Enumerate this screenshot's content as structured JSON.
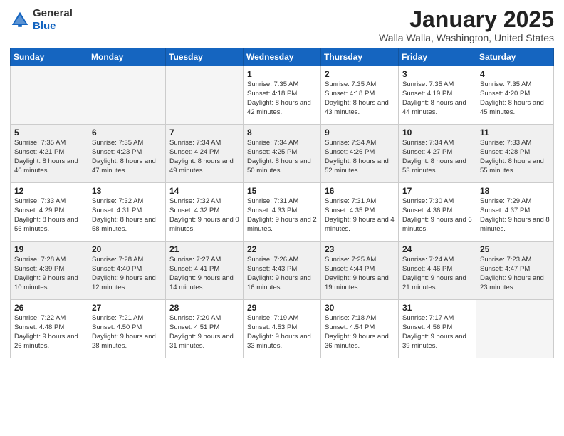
{
  "header": {
    "logo_general": "General",
    "logo_blue": "Blue",
    "month_title": "January 2025",
    "location": "Walla Walla, Washington, United States"
  },
  "weekdays": [
    "Sunday",
    "Monday",
    "Tuesday",
    "Wednesday",
    "Thursday",
    "Friday",
    "Saturday"
  ],
  "weeks": [
    [
      {
        "day": "",
        "info": ""
      },
      {
        "day": "",
        "info": ""
      },
      {
        "day": "",
        "info": ""
      },
      {
        "day": "1",
        "info": "Sunrise: 7:35 AM\nSunset: 4:18 PM\nDaylight: 8 hours and 42 minutes."
      },
      {
        "day": "2",
        "info": "Sunrise: 7:35 AM\nSunset: 4:18 PM\nDaylight: 8 hours and 43 minutes."
      },
      {
        "day": "3",
        "info": "Sunrise: 7:35 AM\nSunset: 4:19 PM\nDaylight: 8 hours and 44 minutes."
      },
      {
        "day": "4",
        "info": "Sunrise: 7:35 AM\nSunset: 4:20 PM\nDaylight: 8 hours and 45 minutes."
      }
    ],
    [
      {
        "day": "5",
        "info": "Sunrise: 7:35 AM\nSunset: 4:21 PM\nDaylight: 8 hours and 46 minutes."
      },
      {
        "day": "6",
        "info": "Sunrise: 7:35 AM\nSunset: 4:23 PM\nDaylight: 8 hours and 47 minutes."
      },
      {
        "day": "7",
        "info": "Sunrise: 7:34 AM\nSunset: 4:24 PM\nDaylight: 8 hours and 49 minutes."
      },
      {
        "day": "8",
        "info": "Sunrise: 7:34 AM\nSunset: 4:25 PM\nDaylight: 8 hours and 50 minutes."
      },
      {
        "day": "9",
        "info": "Sunrise: 7:34 AM\nSunset: 4:26 PM\nDaylight: 8 hours and 52 minutes."
      },
      {
        "day": "10",
        "info": "Sunrise: 7:34 AM\nSunset: 4:27 PM\nDaylight: 8 hours and 53 minutes."
      },
      {
        "day": "11",
        "info": "Sunrise: 7:33 AM\nSunset: 4:28 PM\nDaylight: 8 hours and 55 minutes."
      }
    ],
    [
      {
        "day": "12",
        "info": "Sunrise: 7:33 AM\nSunset: 4:29 PM\nDaylight: 8 hours and 56 minutes."
      },
      {
        "day": "13",
        "info": "Sunrise: 7:32 AM\nSunset: 4:31 PM\nDaylight: 8 hours and 58 minutes."
      },
      {
        "day": "14",
        "info": "Sunrise: 7:32 AM\nSunset: 4:32 PM\nDaylight: 9 hours and 0 minutes."
      },
      {
        "day": "15",
        "info": "Sunrise: 7:31 AM\nSunset: 4:33 PM\nDaylight: 9 hours and 2 minutes."
      },
      {
        "day": "16",
        "info": "Sunrise: 7:31 AM\nSunset: 4:35 PM\nDaylight: 9 hours and 4 minutes."
      },
      {
        "day": "17",
        "info": "Sunrise: 7:30 AM\nSunset: 4:36 PM\nDaylight: 9 hours and 6 minutes."
      },
      {
        "day": "18",
        "info": "Sunrise: 7:29 AM\nSunset: 4:37 PM\nDaylight: 9 hours and 8 minutes."
      }
    ],
    [
      {
        "day": "19",
        "info": "Sunrise: 7:28 AM\nSunset: 4:39 PM\nDaylight: 9 hours and 10 minutes."
      },
      {
        "day": "20",
        "info": "Sunrise: 7:28 AM\nSunset: 4:40 PM\nDaylight: 9 hours and 12 minutes."
      },
      {
        "day": "21",
        "info": "Sunrise: 7:27 AM\nSunset: 4:41 PM\nDaylight: 9 hours and 14 minutes."
      },
      {
        "day": "22",
        "info": "Sunrise: 7:26 AM\nSunset: 4:43 PM\nDaylight: 9 hours and 16 minutes."
      },
      {
        "day": "23",
        "info": "Sunrise: 7:25 AM\nSunset: 4:44 PM\nDaylight: 9 hours and 19 minutes."
      },
      {
        "day": "24",
        "info": "Sunrise: 7:24 AM\nSunset: 4:46 PM\nDaylight: 9 hours and 21 minutes."
      },
      {
        "day": "25",
        "info": "Sunrise: 7:23 AM\nSunset: 4:47 PM\nDaylight: 9 hours and 23 minutes."
      }
    ],
    [
      {
        "day": "26",
        "info": "Sunrise: 7:22 AM\nSunset: 4:48 PM\nDaylight: 9 hours and 26 minutes."
      },
      {
        "day": "27",
        "info": "Sunrise: 7:21 AM\nSunset: 4:50 PM\nDaylight: 9 hours and 28 minutes."
      },
      {
        "day": "28",
        "info": "Sunrise: 7:20 AM\nSunset: 4:51 PM\nDaylight: 9 hours and 31 minutes."
      },
      {
        "day": "29",
        "info": "Sunrise: 7:19 AM\nSunset: 4:53 PM\nDaylight: 9 hours and 33 minutes."
      },
      {
        "day": "30",
        "info": "Sunrise: 7:18 AM\nSunset: 4:54 PM\nDaylight: 9 hours and 36 minutes."
      },
      {
        "day": "31",
        "info": "Sunrise: 7:17 AM\nSunset: 4:56 PM\nDaylight: 9 hours and 39 minutes."
      },
      {
        "day": "",
        "info": ""
      }
    ]
  ]
}
